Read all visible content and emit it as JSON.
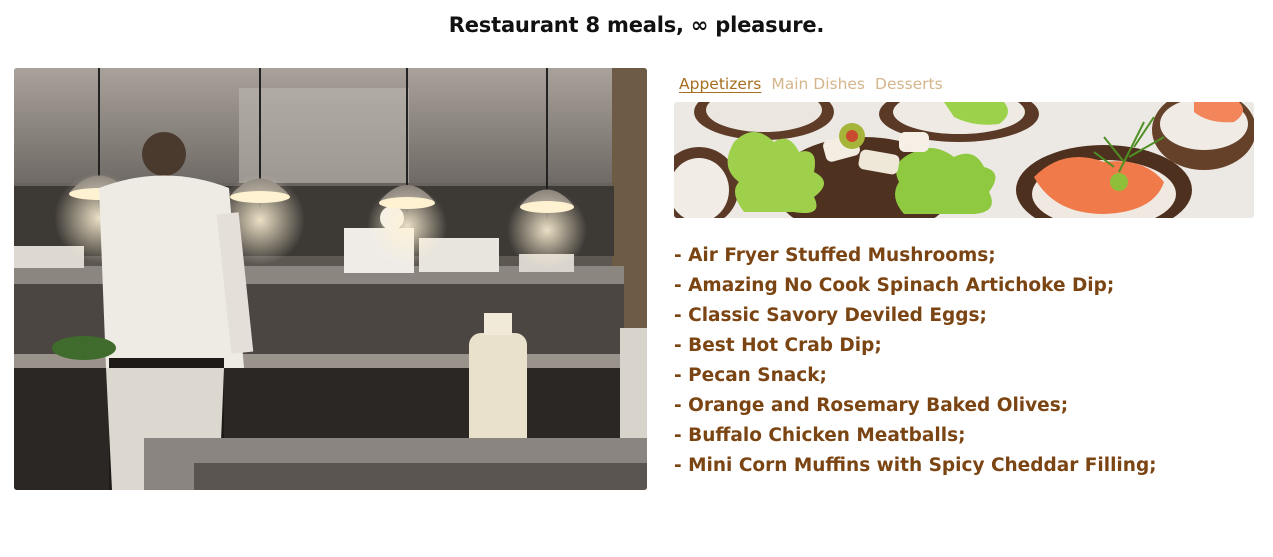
{
  "header": {
    "title": "Restaurant 8 meals, ∞ pleasure."
  },
  "images": {
    "kitchen": "photo of a restaurant kitchen with chefs and pendant lamps",
    "banner": "photo of canapés with smoked salmon, lettuce and dill"
  },
  "tabs": [
    {
      "label": "Appetizers",
      "active": true
    },
    {
      "label": "Main Dishes",
      "active": false
    },
    {
      "label": "Desserts",
      "active": false
    }
  ],
  "menu": {
    "items": [
      "- Air Fryer Stuffed Mushrooms;",
      "- Amazing No Cook Spinach Artichoke Dip;",
      "- Classic Savory Deviled Eggs;",
      "- Best Hot Crab Dip;",
      "- Pecan Snack;",
      "- Orange and Rosemary Baked Olives;",
      "- Buffalo Chicken Meatballs;",
      "- Mini Corn Muffins with Spicy Cheddar Filling;"
    ]
  },
  "colors": {
    "tab_active": "#a66e1f",
    "tab_inactive": "#d4b58c",
    "menu_text": "#7b4513"
  }
}
